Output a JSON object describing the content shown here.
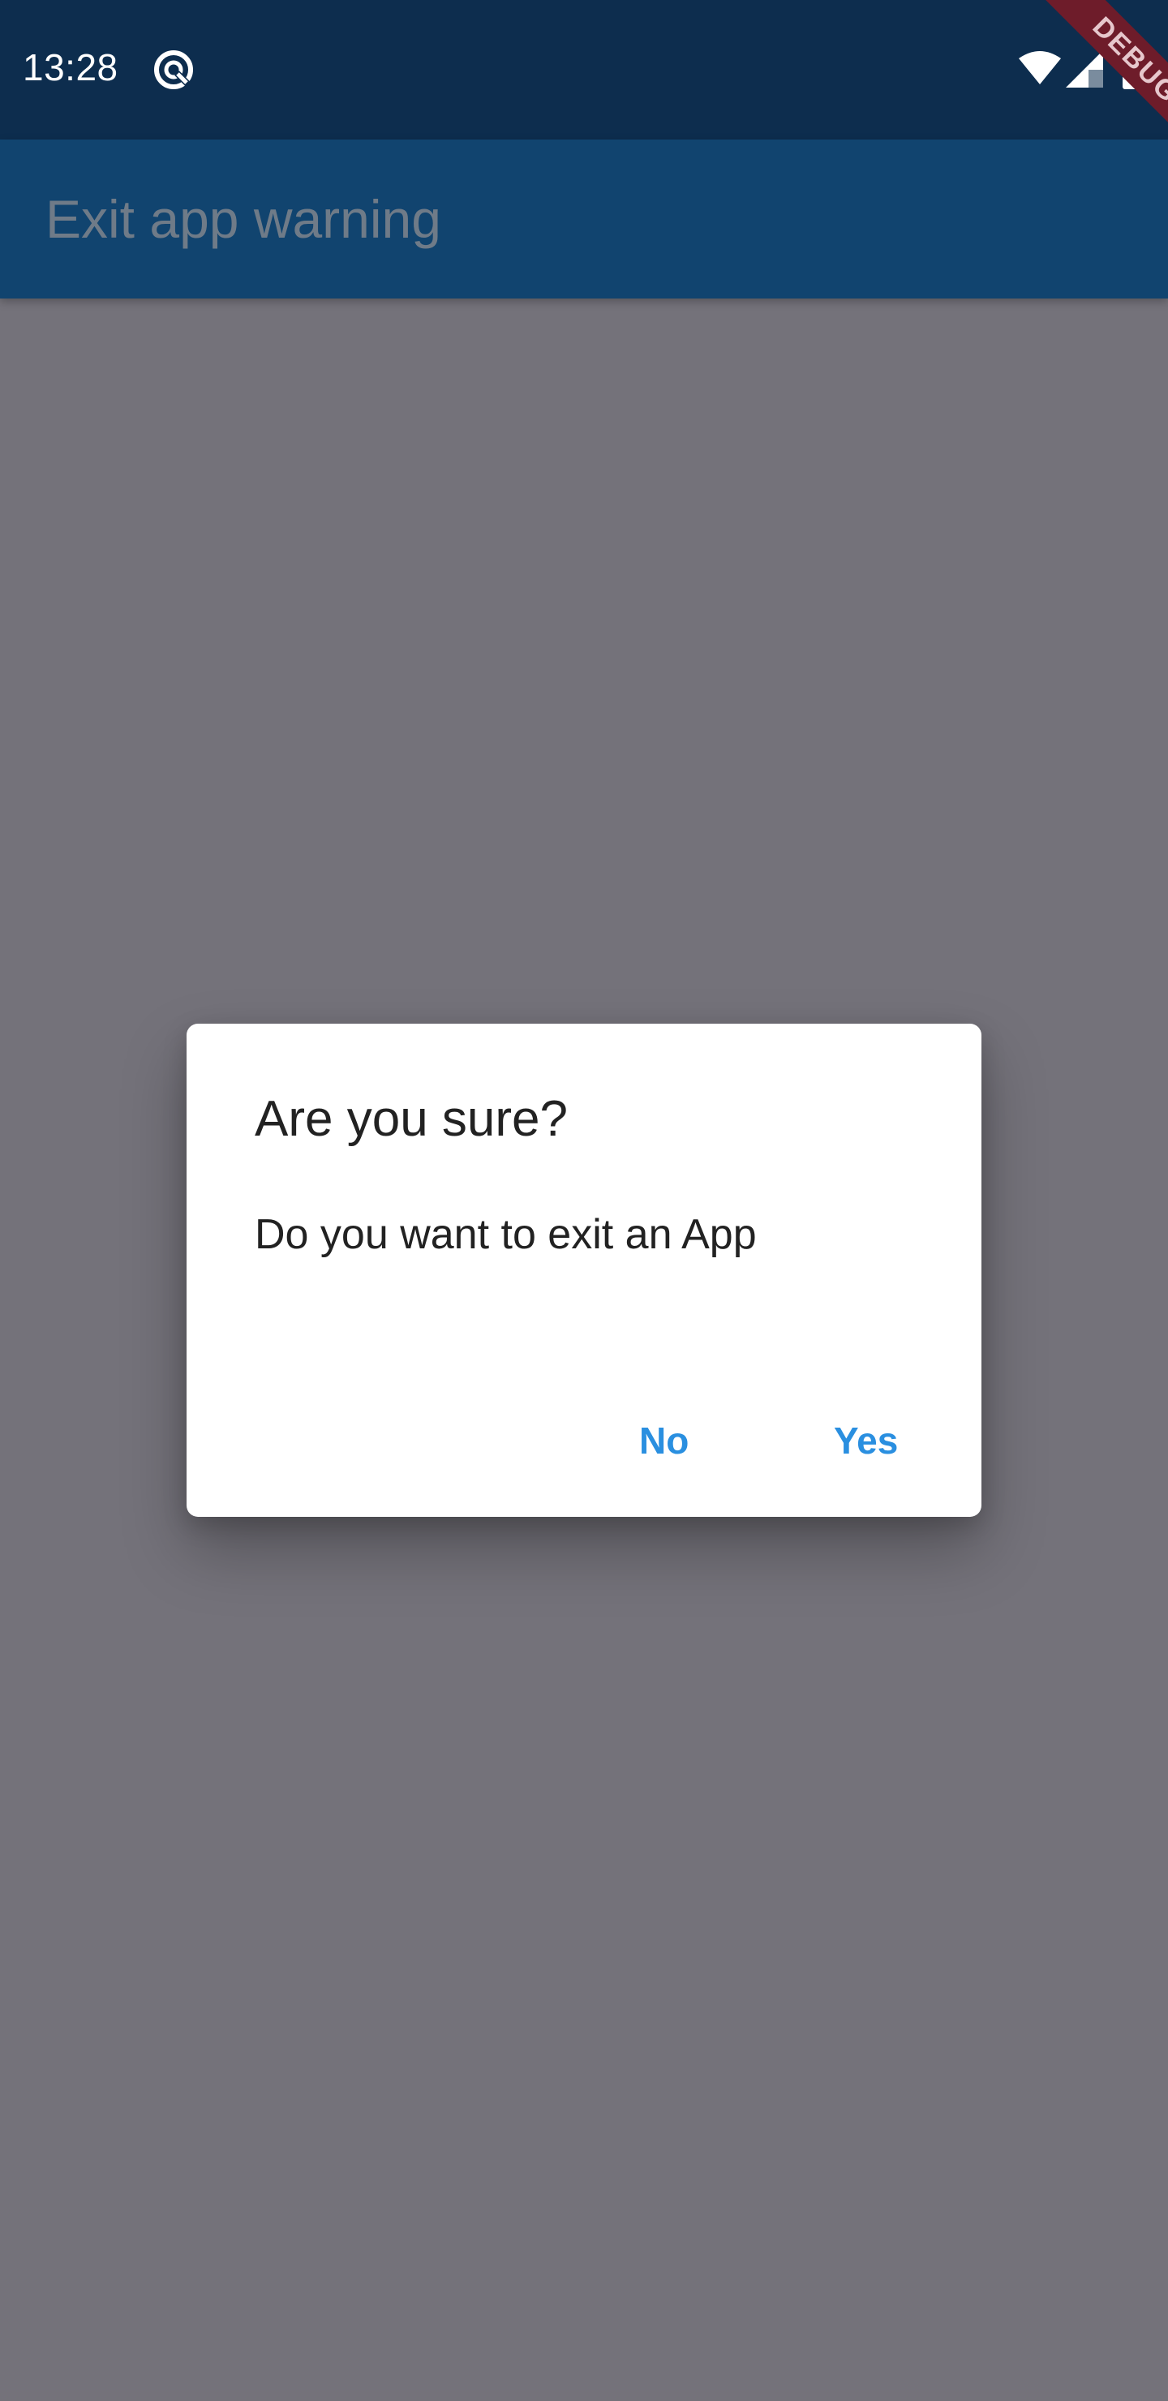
{
  "status_bar": {
    "time": "13:28",
    "icons": [
      "app-notification-icon",
      "wifi-icon",
      "signal-icon",
      "battery-icon"
    ],
    "background_color": "#0d2d4e"
  },
  "debug_banner": "DEBUG",
  "app_bar": {
    "title": "Exit app warning",
    "background_color": "#11446f"
  },
  "dialog": {
    "title": "Are you sure?",
    "message": "Do you want to exit an App",
    "buttons": [
      {
        "label": "No"
      },
      {
        "label": "Yes"
      }
    ],
    "button_color": "#2a8fe0"
  },
  "scrim_color": "#74727a"
}
